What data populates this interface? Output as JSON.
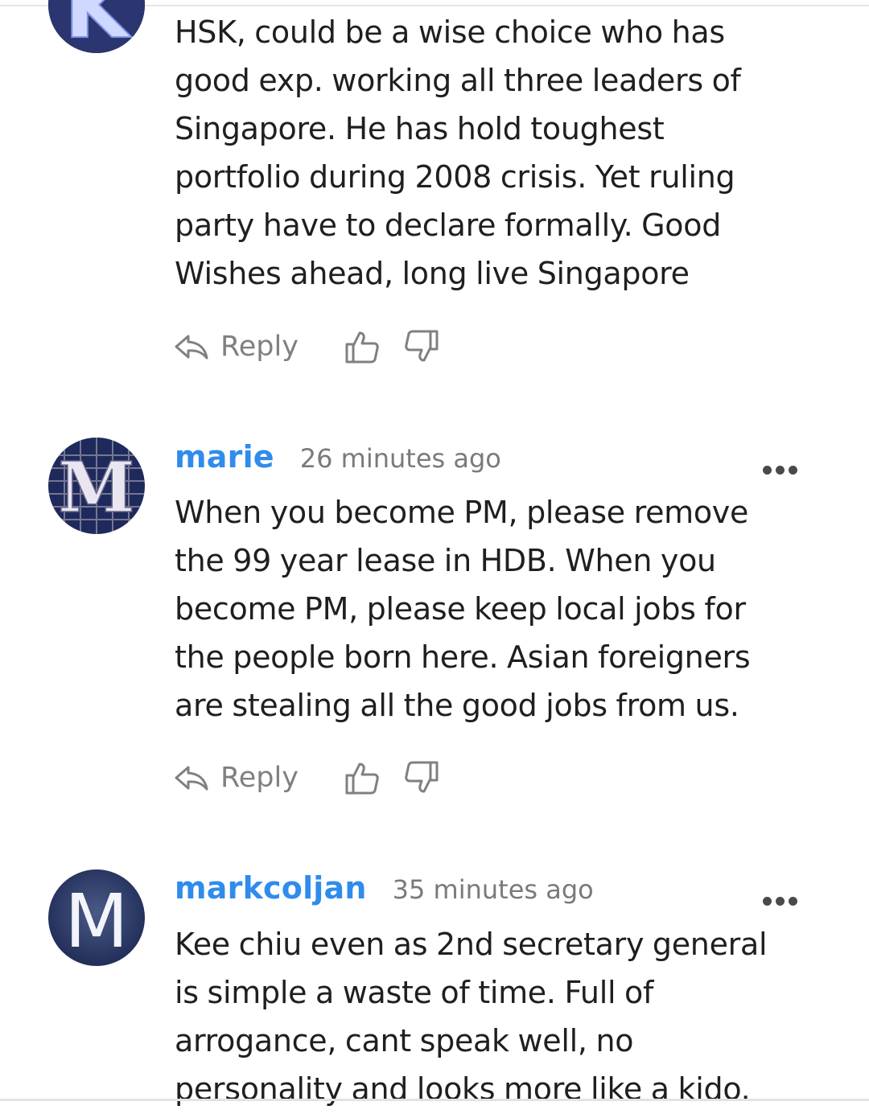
{
  "comments": [
    {
      "username": "",
      "timestamp": "",
      "avatar_letter": "K",
      "lines": [
        "HSK, could be a wise choice who has",
        "good exp. working all three leaders of",
        "Singapore. He has hold toughest",
        "portfolio during 2008 crisis. Yet ruling",
        "party have to declare formally. Good",
        "Wishes ahead, long live Singapore"
      ],
      "reply_label": "Reply"
    },
    {
      "username": "marie",
      "timestamp": "26 minutes ago",
      "avatar_letter": "M",
      "lines": [
        "When you become PM, please remove",
        "the 99 year lease in HDB. When you",
        "become PM, please keep local jobs for",
        "the people born here. Asian foreigners",
        "are stealing all the good jobs from us."
      ],
      "reply_label": "Reply"
    },
    {
      "username": "markcoljan",
      "timestamp": "35 minutes ago",
      "avatar_letter": "M",
      "lines": [
        "Kee chiu even as 2nd secretary general",
        "is simple a waste of time. Full of",
        "arrogance, cant speak well, no",
        "personality and looks more like a kido."
      ]
    }
  ],
  "colors": {
    "username": "#2f8cec",
    "timestamp": "#7a7a7a",
    "body_text": "#1f1f1f",
    "action_gray": "#808080",
    "avatar_navy": "#1f2a5c"
  },
  "icons": {
    "reply": "reply-arrow-icon",
    "like": "thumbs-up-icon",
    "dislike": "thumbs-down-icon",
    "more": "more-dots-icon"
  }
}
